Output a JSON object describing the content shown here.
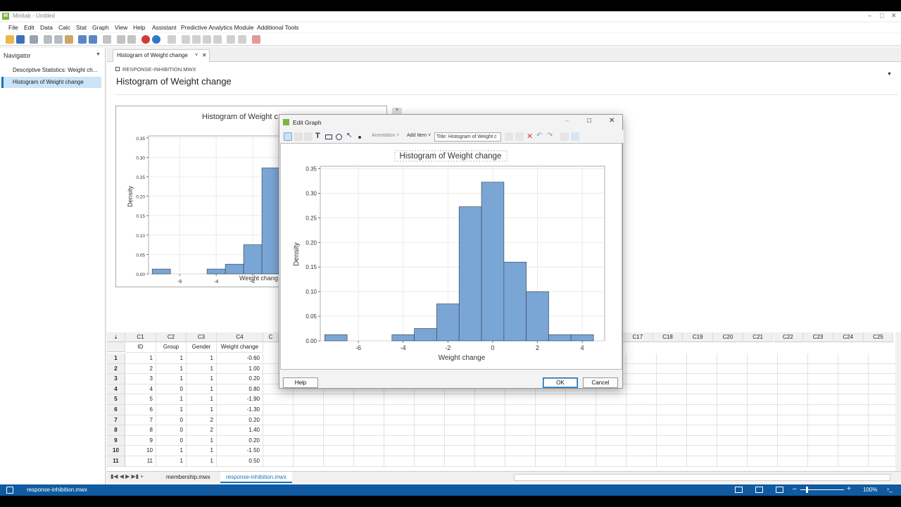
{
  "app": {
    "window_title": "Minitab - Untitled",
    "menus": [
      "File",
      "Edit",
      "Data",
      "Calc",
      "Stat",
      "Graph",
      "View",
      "Help",
      "Assistant",
      "Predictive Analytics Module",
      "Additional Tools"
    ]
  },
  "navigator": {
    "title": "Navigator",
    "items": [
      {
        "label": "Descriptive Statistics: Weight ch..."
      },
      {
        "label": "Histogram of Weight change"
      }
    ]
  },
  "output": {
    "tab_label": "Histogram of Weight change",
    "file_label": "RESPONSE-INHIBITION.MWX",
    "heading": "Histogram of Weight change"
  },
  "background_graph": {
    "title_visible": "Histogram of Weight c",
    "xlabel_visible": "Weight chang",
    "ylabel": "Density"
  },
  "dialog": {
    "title": "Edit Graph",
    "annotation_label": "Annotation",
    "add_item_label": "Add Item",
    "element_select": "Title: Histogram of Weight c",
    "help_label": "Help",
    "ok_label": "OK",
    "cancel_label": "Cancel"
  },
  "chart_data": {
    "type": "bar",
    "title": "Histogram of Weight change",
    "xlabel": "Weight change",
    "ylabel": "Density",
    "bin_edges": [
      -7.5,
      -6.5,
      -5.5,
      -4.5,
      -3.5,
      -2.5,
      -1.5,
      -0.5,
      0.5,
      1.5,
      2.5,
      3.5,
      4.5
    ],
    "values": [
      0.0125,
      0,
      0,
      0.0125,
      0.025,
      0.075,
      0.2725,
      0.3225,
      0.16,
      0.1,
      0.0125,
      0.0125
    ],
    "xticks": [
      -6,
      -4,
      -2,
      0,
      2,
      4
    ],
    "yticks": [
      0.0,
      0.05,
      0.1,
      0.15,
      0.2,
      0.25,
      0.3,
      0.35
    ],
    "xlim": [
      -7.7,
      5.0
    ],
    "ylim": [
      0,
      0.355
    ],
    "grid": true,
    "bar_color": "#7aa6d6"
  },
  "worksheet": {
    "col_ids": [
      "C1",
      "C2",
      "C3",
      "C4"
    ],
    "col_names": [
      "ID",
      "Group",
      "Gender",
      "Weight change"
    ],
    "rows": [
      [
        "1",
        "1",
        "1",
        "-0.60"
      ],
      [
        "2",
        "1",
        "1",
        "1.00"
      ],
      [
        "3",
        "1",
        "1",
        "0.20"
      ],
      [
        "4",
        "0",
        "1",
        "0.80"
      ],
      [
        "5",
        "1",
        "1",
        "-1.90"
      ],
      [
        "6",
        "1",
        "1",
        "-1.30"
      ],
      [
        "7",
        "0",
        "2",
        "0.20"
      ],
      [
        "8",
        "0",
        "2",
        "1.40"
      ],
      [
        "9",
        "0",
        "1",
        "0.20"
      ],
      [
        "10",
        "1",
        "1",
        "-1.50"
      ],
      [
        "11",
        "1",
        "1",
        "0.50"
      ]
    ],
    "right_cols": [
      "C17",
      "C18",
      "C19",
      "C20",
      "C21",
      "C22",
      "C23",
      "C24",
      "C25"
    ],
    "partial_col": "C"
  },
  "sheet_tabs": [
    "membership.mwx",
    "response-inhibition.mwx"
  ],
  "statusbar": {
    "file": "response-inhibition.mwx",
    "zoom": "100%"
  }
}
